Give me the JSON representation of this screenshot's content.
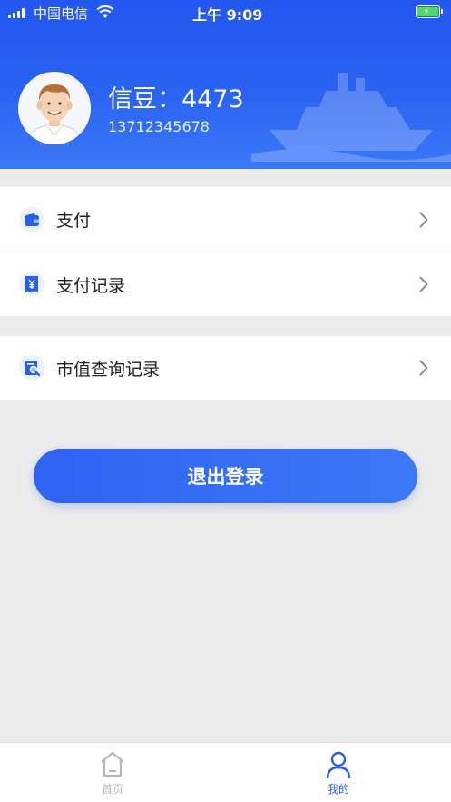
{
  "status_bar": {
    "carrier": "中国电信",
    "time": "上午 9:09"
  },
  "profile": {
    "beans_label": "信豆：4473",
    "phone": "13712345678"
  },
  "menu": {
    "group1": [
      {
        "label": "支付",
        "icon": "wallet-icon"
      },
      {
        "label": "支付记录",
        "icon": "receipt-yen-icon"
      }
    ],
    "group2": [
      {
        "label": "市值查询记录",
        "icon": "search-document-icon"
      }
    ]
  },
  "logout_label": "退出登录",
  "tabs": [
    {
      "label": "首页",
      "icon": "home-icon",
      "active": false
    },
    {
      "label": "我的",
      "icon": "person-icon",
      "active": true
    }
  ],
  "colors": {
    "primary": "#2a5ee8",
    "header": "#2357f0",
    "background": "#ececec"
  }
}
